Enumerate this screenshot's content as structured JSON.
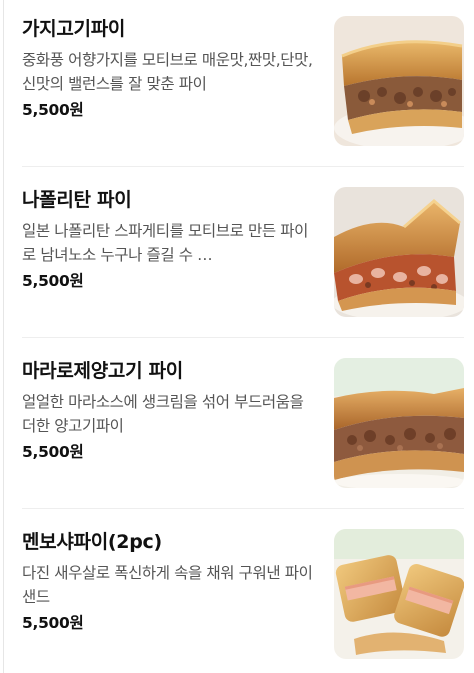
{
  "menu": {
    "items": [
      {
        "name": "가지고기파이",
        "description": "중화풍 어향가지를 모티브로 매운맛,짠맛,단맛,신맛의 밸런스를 잘 맞춘 파이",
        "price": "5,500원",
        "image": "photo of baked pie with eggplant and meat filling"
      },
      {
        "name": "나폴리탄 파이",
        "description": "일본 나폴리탄 스파게티를 모티브로 만든 파이로 남녀노소 누구나 즐길 수 …",
        "price": "5,500원",
        "image": "photo of baked pie with sausage and tomato filling"
      },
      {
        "name": "마라로제양고기 파이",
        "description": "얼얼한 마라소스에 생크림을 섞어 부드러움을 더한 양고기파이",
        "price": "5,500원",
        "image": "photo of baked pie with lamb filling"
      },
      {
        "name": "멘보샤파이(2pc)",
        "description": "다진 새우살로 폭신하게 속을 채워 구워낸 파이샌드",
        "price": "5,500원",
        "image": "photo of two shrimp-filled puff pastry sandwiches"
      }
    ]
  }
}
